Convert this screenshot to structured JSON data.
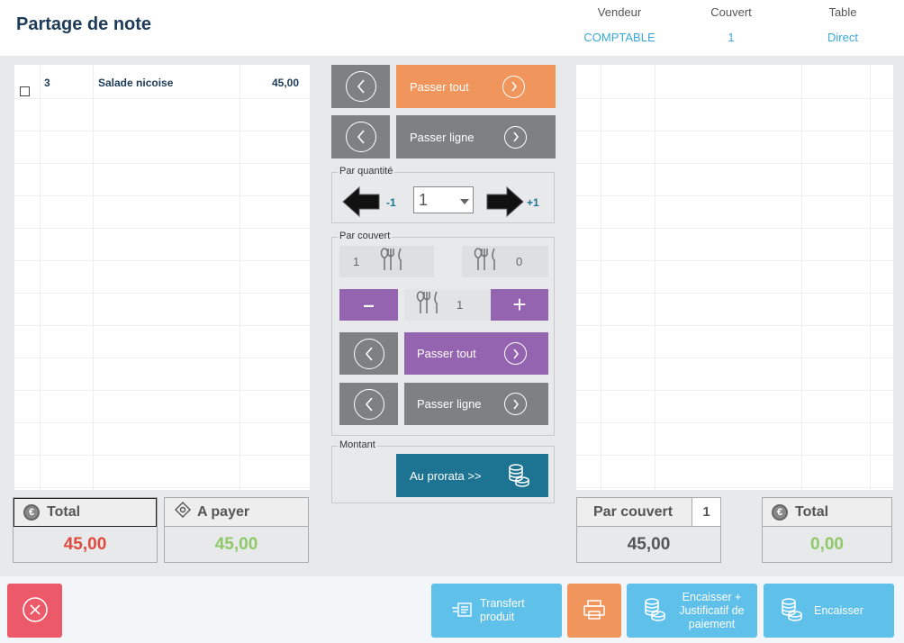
{
  "header": {
    "title": "Partage de note",
    "columns": [
      {
        "label": "Vendeur",
        "value": "COMPTABLE"
      },
      {
        "label": "Couvert",
        "value": "1"
      },
      {
        "label": "Table",
        "value": "Direct"
      }
    ]
  },
  "left_list": {
    "rows": [
      {
        "qty": "3",
        "name": "Salade nicoise",
        "price": "45,00"
      }
    ]
  },
  "transfer_all": {
    "label": "Passer tout"
  },
  "transfer_line": {
    "label": "Passer ligne"
  },
  "by_quantity": {
    "label": "Par quantité",
    "minus_label": "-1",
    "plus_label": "+1",
    "selected": "1"
  },
  "by_cover": {
    "label": "Par couvert",
    "left_count": "1",
    "right_count": "0",
    "minus": "–",
    "plus": "+",
    "current": "1",
    "pass_all": "Passer tout",
    "pass_line": "Passer ligne"
  },
  "amount": {
    "label": "Montant",
    "prorata": "Au prorata >>"
  },
  "totals_left": {
    "total_label": "Total",
    "total_value": "45,00",
    "to_pay_label": "A payer",
    "to_pay_value": "45,00"
  },
  "totals_right": {
    "per_cover_label": "Par couvert",
    "per_cover_count": "1",
    "per_cover_value": "45,00",
    "total_label": "Total",
    "total_value": "0,00"
  },
  "footer": {
    "transfer_product": "Transfert produit",
    "cash_in_receipt": "Encaisser + Justificatif de paiement",
    "cash_in": "Encaisser"
  },
  "colors": {
    "orange": "#f0965c",
    "purple": "#9564b1",
    "teal": "#1d7392",
    "blue": "#5fc0ea",
    "red": "#ec5a6a",
    "total_red": "#e04a3f",
    "pay_green": "#8fc96a"
  }
}
